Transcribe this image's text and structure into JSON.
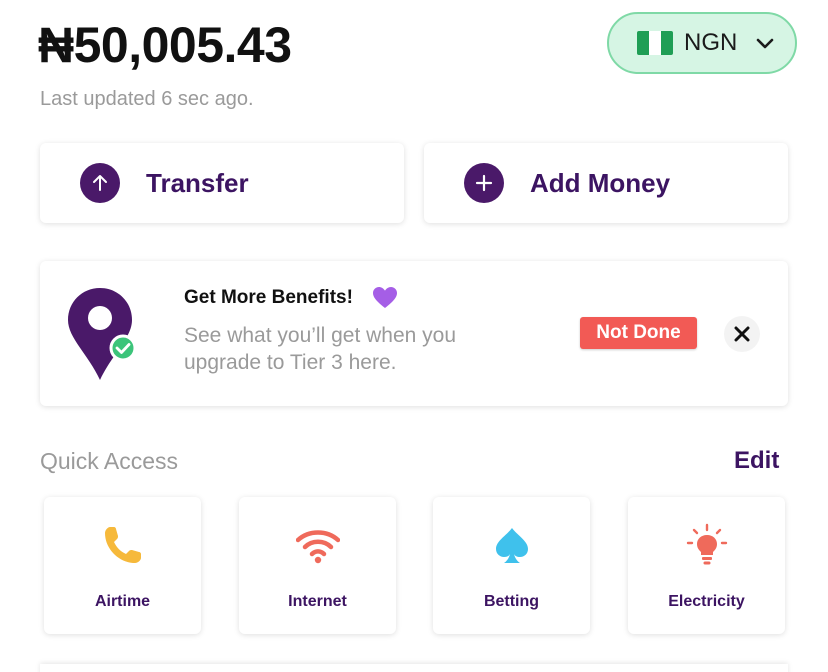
{
  "balance": {
    "amount": "₦50,005.43",
    "updated": "Last updated 6 sec ago."
  },
  "currency": {
    "code": "NGN",
    "flag": "nigeria-flag-icon",
    "bg": "#d6f5e4",
    "border": "#7fd9a6"
  },
  "actions": [
    {
      "label": "Transfer",
      "icon": "arrow-up-icon"
    },
    {
      "label": "Add Money",
      "icon": "plus-icon"
    }
  ],
  "banner": {
    "title": "Get More Benefits!",
    "description": "See what you’ll get when you upgrade to Tier 3 here.",
    "status": "Not Done",
    "status_color": "#f25a55"
  },
  "quick_access": {
    "title": "Quick Access",
    "edit": "Edit",
    "items": [
      {
        "label": "Airtime",
        "icon": "phone-icon",
        "color": "#f6b93b"
      },
      {
        "label": "Internet",
        "icon": "wifi-icon",
        "color": "#ef6a5b"
      },
      {
        "label": "Betting",
        "icon": "spade-icon",
        "color": "#3fc1ec"
      },
      {
        "label": "Electricity",
        "icon": "lightbulb-icon",
        "color": "#ef6a5b"
      }
    ]
  },
  "colors": {
    "primary": "#4a1969",
    "text_purple": "#3c1462"
  }
}
